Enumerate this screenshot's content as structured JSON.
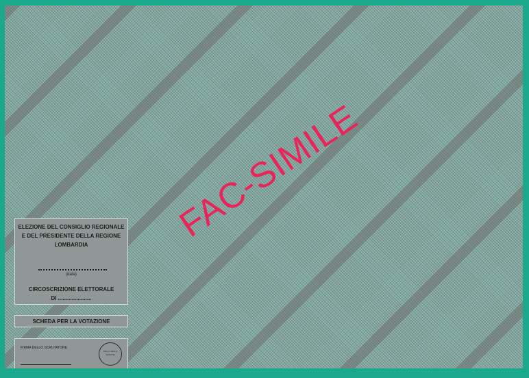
{
  "watermark": "FAC-SIMILE",
  "header": {
    "line1": "ELEZIONE DEL CONSIGLIO REGIONALE",
    "line2": "E DEL PRESIDENTE DELLA REGIONE",
    "line3": "LOMBARDIA",
    "date_label": "(data)",
    "circ_label": "CIRCOSCRIZIONE ELETTORALE",
    "circ_of": "DI ......................"
  },
  "ballot": {
    "label": "SCHEDA PER LA VOTAZIONE"
  },
  "signature": {
    "label": "FIRMA DELLO SCRUTATORE",
    "seal_text": "BOLLO DELLA SEZIONE"
  },
  "colors": {
    "border": "#1aa98a",
    "watermark": "#e8245a"
  }
}
